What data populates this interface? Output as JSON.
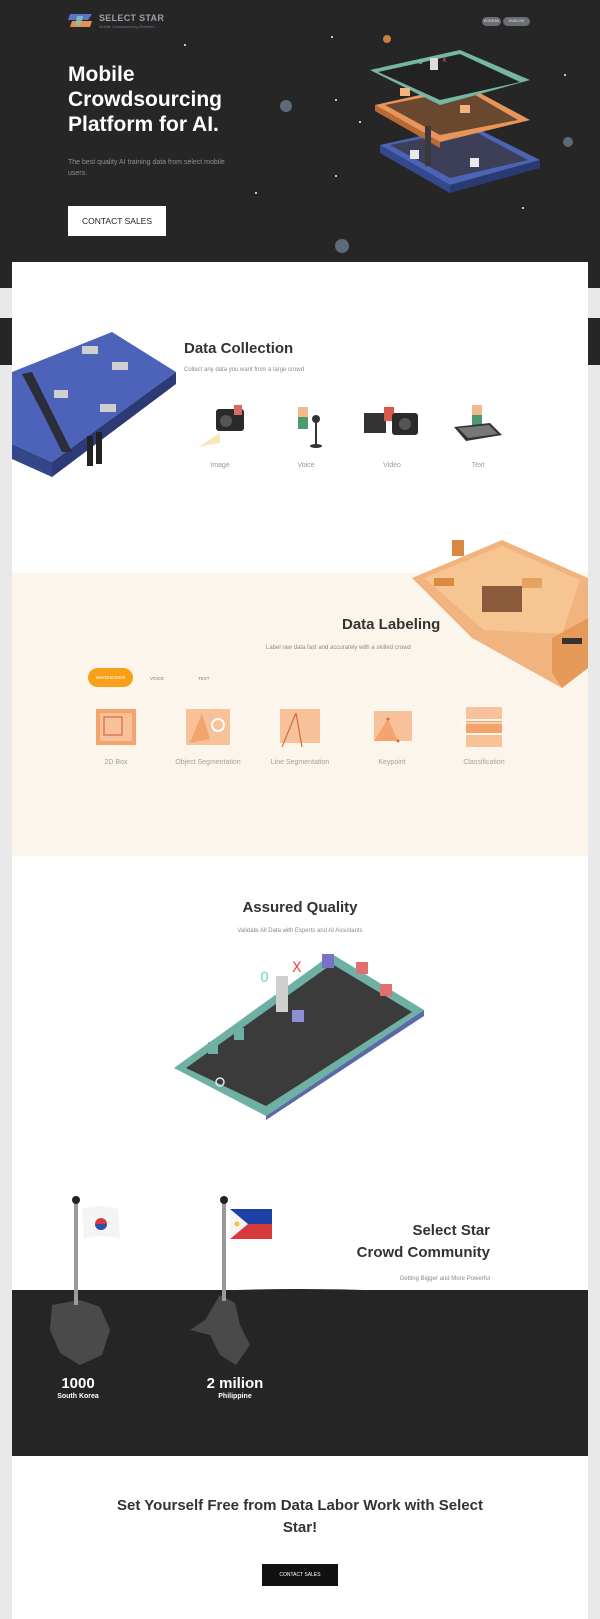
{
  "header": {
    "brand": "SELECT STAR",
    "tagline": "Mobile Crowdsourcing Platform",
    "lang": [
      "KOREAN",
      "ENGLISH"
    ],
    "title": "Mobile Crowdsourcing Platform for AI.",
    "subtitle": "The best quality AI training data from select mobile users.",
    "contact_label": "CONTACT SALES"
  },
  "data_collection": {
    "title": "Data Collection",
    "subtitle": "Collect any data you want from a large crowd",
    "items": [
      {
        "label": "Image",
        "icon": "camera-icon"
      },
      {
        "label": "Voice",
        "icon": "microphone-icon"
      },
      {
        "label": "Video",
        "icon": "video-camera-icon"
      },
      {
        "label": "Text",
        "icon": "keyboard-icon"
      }
    ]
  },
  "data_labeling": {
    "title": "Data Labeling",
    "subtitle": "Label raw data fast and accurately with a skilled crowd",
    "tabs": [
      "IMAGE&VIDEO",
      "VOICE",
      "TEXT"
    ],
    "items": [
      {
        "label": "2D Box"
      },
      {
        "label": "Object Segmentation"
      },
      {
        "label": "Line Segmentation"
      },
      {
        "label": "Keypoint"
      },
      {
        "label": "Classification"
      }
    ]
  },
  "quality": {
    "title": "Assured Quality",
    "subtitle": "Validate All Data with Experts and AI Assistants"
  },
  "community": {
    "title_line1": "Select Star",
    "title_line2": "Crowd Community",
    "subtitle": "Getting Bigger and More Powerful",
    "stats": [
      {
        "number": "1000",
        "country": "South Korea"
      },
      {
        "number": "2 milion",
        "country": "Philippine"
      }
    ]
  },
  "cta": {
    "title": "Set Yourself Free from Data Labor Work with Select Star!",
    "button": "CONTACT SALES"
  },
  "colors": {
    "dark": "#262626",
    "accent": "#f8a019",
    "labeling_bg": "#fcf5ec"
  }
}
